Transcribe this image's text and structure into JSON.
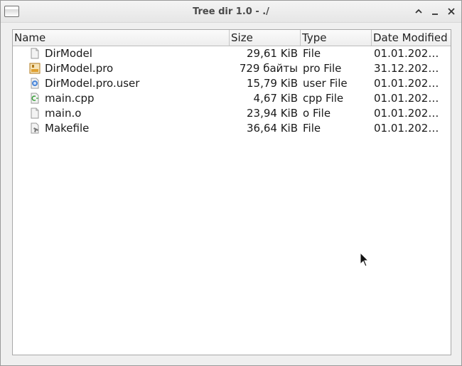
{
  "window": {
    "title": "Tree dir 1.0 - ./"
  },
  "header": {
    "name": "Name",
    "size": "Size",
    "type": "Type",
    "date": "Date Modified"
  },
  "rows": [
    {
      "name": "DirModel",
      "size": "29,61 KiB",
      "type": "File",
      "date": "01.01.202…",
      "icon": "generic-file-icon"
    },
    {
      "name": "DirModel.pro",
      "size": "729 байты",
      "type": "pro File",
      "date": "31.12.202…",
      "icon": "qt-project-file-icon"
    },
    {
      "name": "DirModel.pro.user",
      "size": "15,79 KiB",
      "type": "user File",
      "date": "01.01.202…",
      "icon": "user-file-icon"
    },
    {
      "name": "main.cpp",
      "size": "4,67 KiB",
      "type": "cpp File",
      "date": "01.01.202…",
      "icon": "cpp-file-icon"
    },
    {
      "name": "main.o",
      "size": "23,94 KiB",
      "type": "o File",
      "date": "01.01.202…",
      "icon": "generic-file-icon"
    },
    {
      "name": "Makefile",
      "size": "36,64 KiB",
      "type": "File",
      "date": "01.01.202…",
      "icon": "makefile-icon"
    }
  ]
}
